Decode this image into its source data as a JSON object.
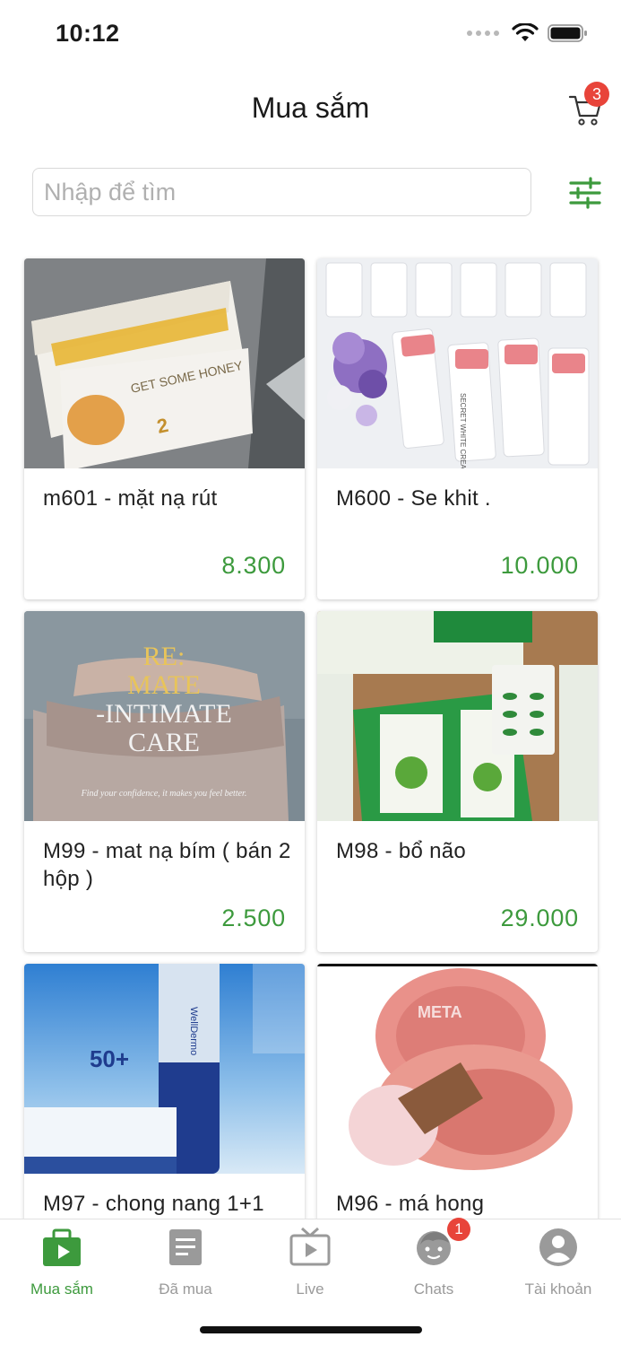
{
  "status_bar": {
    "time": "10:12"
  },
  "header": {
    "title": "Mua sắm",
    "cart_count": "3"
  },
  "search": {
    "placeholder": "Nhập để tìm",
    "value": ""
  },
  "products": [
    {
      "title": "m601 - mặt nạ rút",
      "price": "8.300"
    },
    {
      "title": "M600 - Se khit .",
      "price": "10.000"
    },
    {
      "title": "M99 - mat nạ bím ( bán 2 hộp )",
      "price": "2.500"
    },
    {
      "title": "M98 - bổ não",
      "price": "29.000"
    },
    {
      "title": "M97 - chong nang 1+1",
      "price": ""
    },
    {
      "title": "M96 - má hong",
      "price": ""
    }
  ],
  "image_text": {
    "honey_box": "GET SOME HONEY",
    "cream_box": "SECRET WHITE CREAM",
    "remate_line1": "RE:",
    "remate_line2": "MATE",
    "remate_line3": "-INTIMATE",
    "remate_line4": "CARE",
    "remate_tag": "Find your confidence, it makes you feel better.",
    "spf": "50+",
    "sunscreen_brand": "WellDermo",
    "blush_watermark": "META"
  },
  "tabbar": {
    "tabs": [
      {
        "label": "Mua sắm",
        "icon": "shopping-bag-icon",
        "active": true
      },
      {
        "label": "Đã mua",
        "icon": "document-icon",
        "active": false
      },
      {
        "label": "Live",
        "icon": "tv-icon",
        "active": false
      },
      {
        "label": "Chats",
        "icon": "chat-face-icon",
        "active": false,
        "badge": "1"
      },
      {
        "label": "Tài khoản",
        "icon": "account-icon",
        "active": false
      }
    ]
  },
  "colors": {
    "accent": "#3d9a3d",
    "badge": "#e8443a",
    "inactive": "#9a9a9a"
  }
}
